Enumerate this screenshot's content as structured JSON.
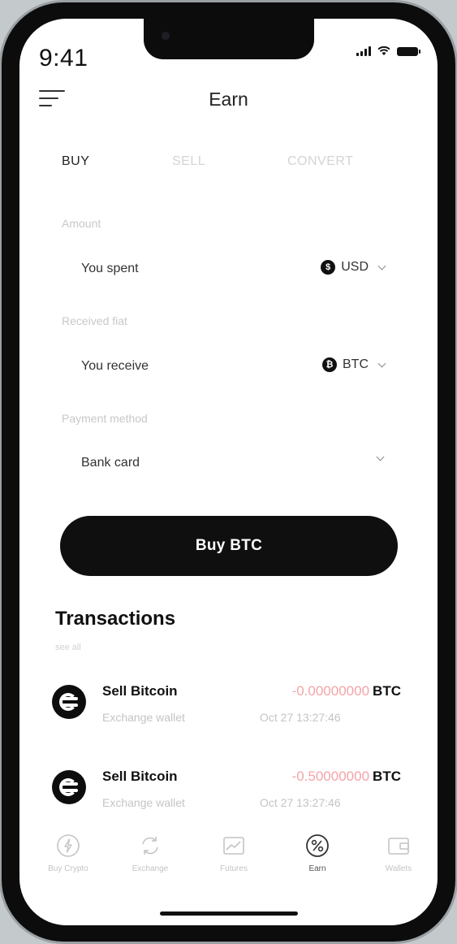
{
  "status_bar": {
    "time": "9:41"
  },
  "header": {
    "title": "Earn"
  },
  "tabs": [
    {
      "label": "BUY",
      "active": true
    },
    {
      "label": "SELL",
      "active": false
    },
    {
      "label": "CONVERT",
      "active": false
    }
  ],
  "form": {
    "amount": {
      "label": "Amount",
      "text": "You spent",
      "currency": "USD",
      "coin_symbol": "$"
    },
    "received": {
      "label": "Received fiat",
      "text": "You receive",
      "currency": "BTC",
      "coin_symbol": "₿"
    },
    "payment": {
      "label": "Payment method",
      "value": "Bank card"
    }
  },
  "buy_button": {
    "label": "Buy BTC"
  },
  "transactions": {
    "title": "Transactions",
    "subtitle": "see all",
    "items": [
      {
        "name": "Sell Bitcoin",
        "source": "Exchange wallet",
        "amount": "-0.00000000",
        "unit": "BTC",
        "date": "Oct 27 13:27:46"
      },
      {
        "name": "Sell Bitcoin",
        "source": "Exchange wallet",
        "amount": "-0.50000000",
        "unit": "BTC",
        "date": "Oct 27 13:27:46"
      }
    ]
  },
  "bottom_nav": [
    {
      "label": "Buy Crypto",
      "icon": "lightning-icon",
      "active": false
    },
    {
      "label": "Exchange",
      "icon": "exchange-icon",
      "active": false
    },
    {
      "label": "Futures",
      "icon": "chart-icon",
      "active": false
    },
    {
      "label": "Earn",
      "icon": "percent-icon",
      "active": true
    },
    {
      "label": "Wallets",
      "icon": "wallet-icon",
      "active": false
    }
  ],
  "colors": {
    "accent": "#0f0f0f",
    "negative_amount": "#f4a3a8",
    "muted_text": "#c4c4c4"
  }
}
